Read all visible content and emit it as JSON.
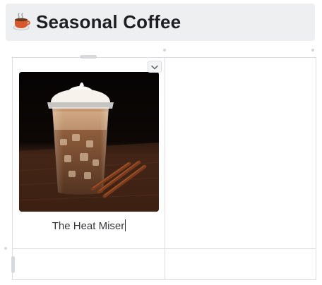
{
  "page": {
    "icon": "coffee-cup-icon",
    "title": "Seasonal Coffee"
  },
  "grid": {
    "cells": [
      {
        "image": "iced-coffee-photo",
        "caption": "The Heat Miser",
        "menu_icon": "chevron-down-icon"
      },
      {},
      {},
      {}
    ]
  },
  "colors": {
    "header_background": "#eeeff1",
    "title_text": "#1f1f23",
    "grid_lines": "#dcdee2",
    "caption_text": "#333539"
  }
}
